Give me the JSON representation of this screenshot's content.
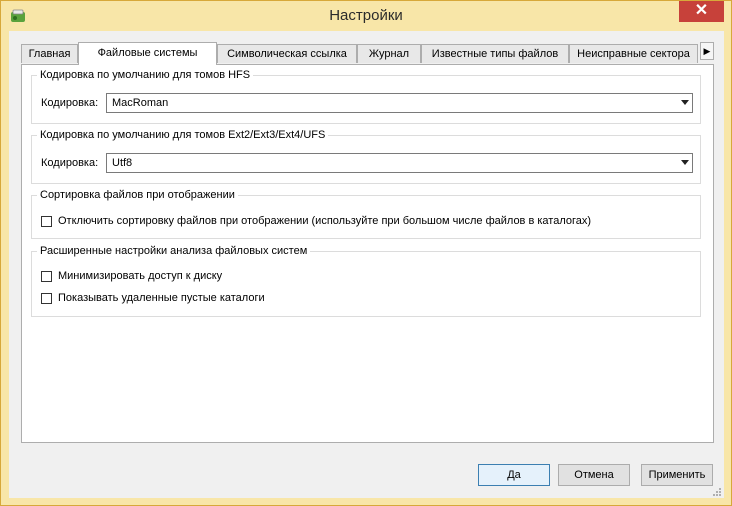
{
  "window": {
    "title": "Настройки",
    "close_glyph": "✕"
  },
  "tabs": [
    {
      "label": "Главная",
      "active": false
    },
    {
      "label": "Файловые системы",
      "active": true
    },
    {
      "label": "Символическая ссылка",
      "active": false
    },
    {
      "label": "Журнал",
      "active": false
    },
    {
      "label": "Известные типы файлов",
      "active": false
    },
    {
      "label": "Неисправные сектора",
      "active": false
    }
  ],
  "tab_scroll_glyph": "▶",
  "groups": {
    "hfs": {
      "title": "Кодировка по умолчанию для томов HFS",
      "label": "Кодировка:",
      "value": "MacRoman"
    },
    "ext": {
      "title": "Кодировка по умолчанию для томов Ext2/Ext3/Ext4/UFS",
      "label": "Кодировка:",
      "value": "Utf8"
    },
    "sort": {
      "title": "Сортировка файлов при отображении",
      "checkbox_label": "Отключить сортировку файлов при отображении (используйте при большом числе файлов в каталогах)",
      "checked": false
    },
    "advanced": {
      "title": "Расширенные настройки анализа файловых систем",
      "options": [
        {
          "label": "Минимизировать доступ к диску",
          "checked": false
        },
        {
          "label": "Показывать удаленные пустые каталоги",
          "checked": false
        }
      ]
    }
  },
  "buttons": {
    "ok": "Да",
    "cancel": "Отмена",
    "apply": "Применить"
  },
  "colors": {
    "frame": "#f8e6a8",
    "close": "#c7413a",
    "default_button_border": "#3c7fb1"
  }
}
